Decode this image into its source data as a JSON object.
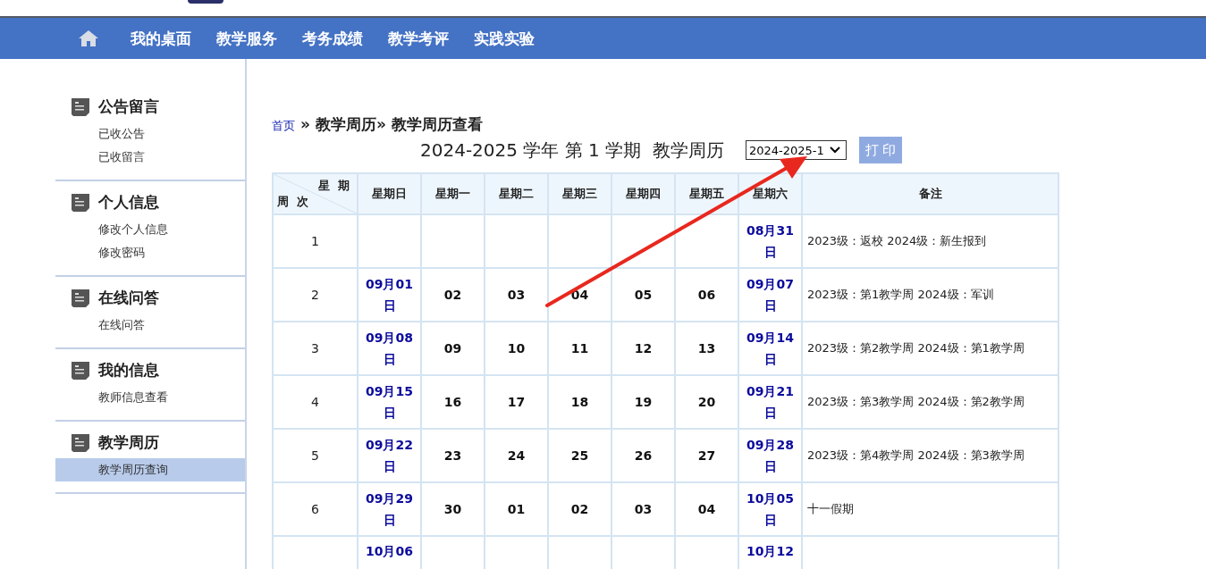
{
  "nav": {
    "items": [
      "我的桌面",
      "教学服务",
      "考务成绩",
      "教学考评",
      "实践实验"
    ]
  },
  "sidebar": {
    "sections": [
      {
        "title": "公告留言",
        "items": [
          {
            "label": "已收公告",
            "selected": false
          },
          {
            "label": "已收留言",
            "selected": false
          }
        ]
      },
      {
        "title": "个人信息",
        "items": [
          {
            "label": "修改个人信息",
            "selected": false
          },
          {
            "label": "修改密码",
            "selected": false
          }
        ]
      },
      {
        "title": "在线问答",
        "items": [
          {
            "label": "在线问答",
            "selected": false
          }
        ]
      },
      {
        "title": "我的信息",
        "items": [
          {
            "label": "教师信息查看",
            "selected": false
          }
        ]
      },
      {
        "title": "教学周历",
        "items": [
          {
            "label": "教学周历查询",
            "selected": true
          }
        ]
      }
    ]
  },
  "breadcrumb": {
    "home": "首页",
    "trail": "» 教学周历» 教学周历查看"
  },
  "title": "2024-2025 学年 第 1 学期  教学周历",
  "term_select": {
    "value": "2024-2025-1"
  },
  "print_button": "打 印",
  "table": {
    "corner": {
      "top": "星 期",
      "bottom": "周 次"
    },
    "columns": [
      "星期日",
      "星期一",
      "星期二",
      "星期三",
      "星期四",
      "星期五",
      "星期六",
      "备注"
    ],
    "rows": [
      {
        "week": "1",
        "days": [
          {
            "kind": "empty"
          },
          {
            "kind": "empty"
          },
          {
            "kind": "empty"
          },
          {
            "kind": "empty"
          },
          {
            "kind": "empty"
          },
          {
            "kind": "empty"
          },
          {
            "kind": "date",
            "text": "08月31日"
          }
        ],
        "note": "2023级：返校 2024级：新生报到"
      },
      {
        "week": "2",
        "days": [
          {
            "kind": "date",
            "text": "09月01日"
          },
          {
            "kind": "day",
            "text": "02"
          },
          {
            "kind": "day",
            "text": "03"
          },
          {
            "kind": "day",
            "text": "04"
          },
          {
            "kind": "day",
            "text": "05"
          },
          {
            "kind": "day",
            "text": "06"
          },
          {
            "kind": "date",
            "text": "09月07日"
          }
        ],
        "note": "2023级：第1教学周 2024级：军训"
      },
      {
        "week": "3",
        "days": [
          {
            "kind": "date",
            "text": "09月08日"
          },
          {
            "kind": "day",
            "text": "09"
          },
          {
            "kind": "day",
            "text": "10"
          },
          {
            "kind": "day",
            "text": "11"
          },
          {
            "kind": "day",
            "text": "12"
          },
          {
            "kind": "day",
            "text": "13"
          },
          {
            "kind": "date",
            "text": "09月14日"
          }
        ],
        "note": "2023级：第2教学周 2024级：第1教学周"
      },
      {
        "week": "4",
        "days": [
          {
            "kind": "date",
            "text": "09月15日"
          },
          {
            "kind": "day",
            "text": "16"
          },
          {
            "kind": "day",
            "text": "17"
          },
          {
            "kind": "day",
            "text": "18"
          },
          {
            "kind": "day",
            "text": "19"
          },
          {
            "kind": "day",
            "text": "20"
          },
          {
            "kind": "date",
            "text": "09月21日"
          }
        ],
        "note": "2023级：第3教学周 2024级：第2教学周"
      },
      {
        "week": "5",
        "days": [
          {
            "kind": "date",
            "text": "09月22日"
          },
          {
            "kind": "day",
            "text": "23"
          },
          {
            "kind": "day",
            "text": "24"
          },
          {
            "kind": "day",
            "text": "25"
          },
          {
            "kind": "day",
            "text": "26"
          },
          {
            "kind": "day",
            "text": "27"
          },
          {
            "kind": "date",
            "text": "09月28日"
          }
        ],
        "note": "2023级：第4教学周 2024级：第3教学周"
      },
      {
        "week": "6",
        "days": [
          {
            "kind": "date",
            "text": "09月29日"
          },
          {
            "kind": "day",
            "text": "30"
          },
          {
            "kind": "day",
            "text": "01"
          },
          {
            "kind": "day",
            "text": "02"
          },
          {
            "kind": "day",
            "text": "03"
          },
          {
            "kind": "day",
            "text": "04"
          },
          {
            "kind": "date",
            "text": "10月05日"
          }
        ],
        "note": "十一假期"
      },
      {
        "days": [
          {
            "kind": "date",
            "text": "10月06"
          },
          {
            "kind": "empty"
          },
          {
            "kind": "empty"
          },
          {
            "kind": "empty"
          },
          {
            "kind": "empty"
          },
          {
            "kind": "empty"
          },
          {
            "kind": "date",
            "text": "10月12"
          }
        ]
      }
    ]
  }
}
